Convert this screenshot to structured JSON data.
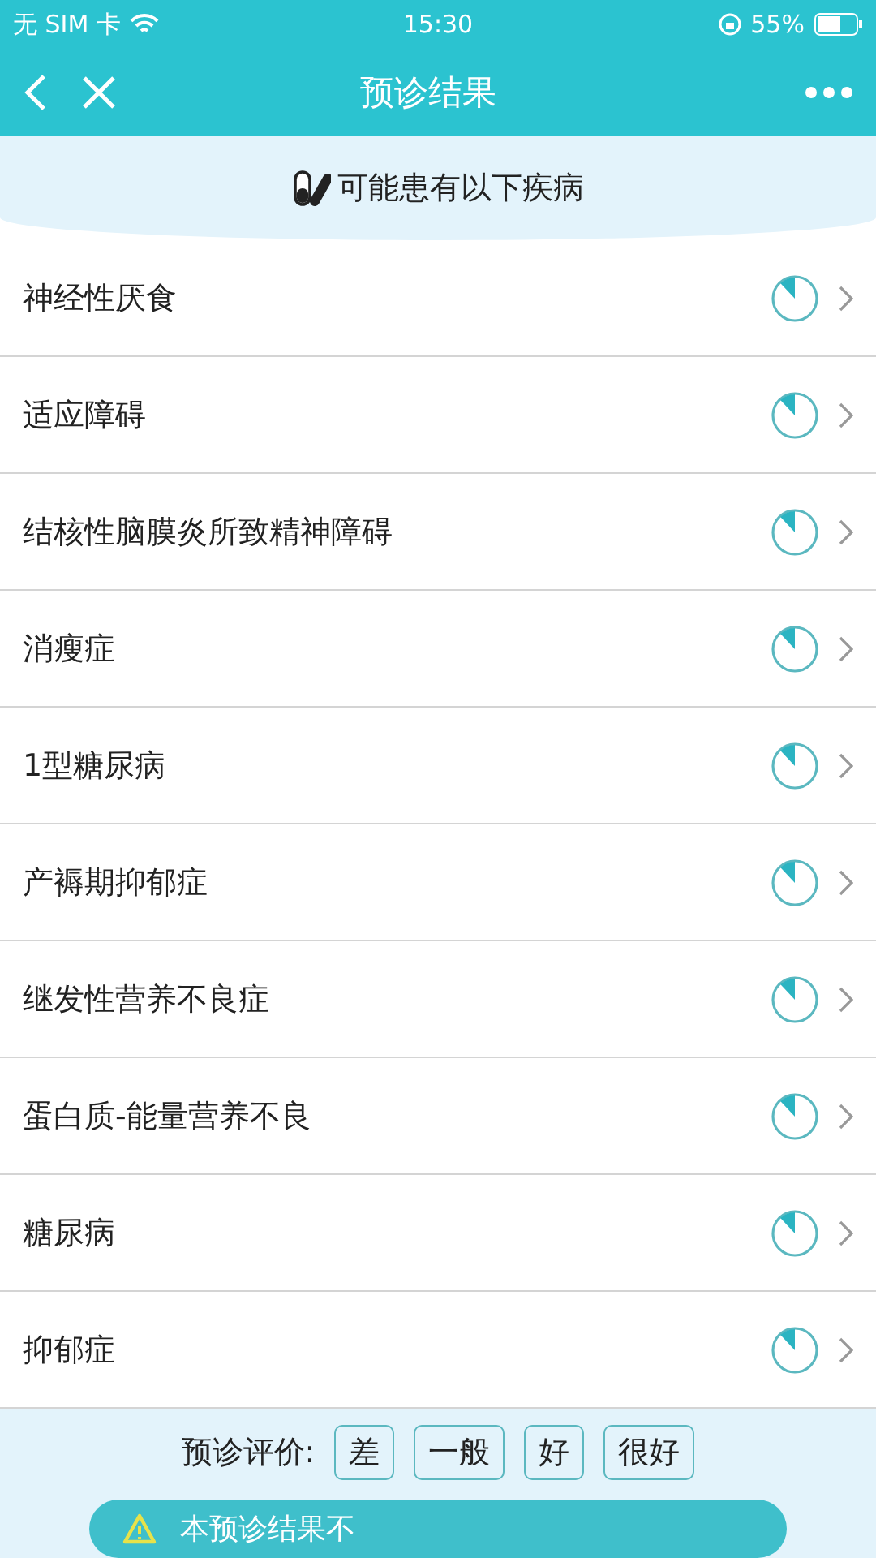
{
  "status_bar": {
    "carrier": "无 SIM 卡",
    "time": "15:30",
    "battery": "55%"
  },
  "nav": {
    "title": "预诊结果"
  },
  "header": {
    "text": "可能患有以下疾病"
  },
  "diseases": [
    {
      "name": "神经性厌食"
    },
    {
      "name": "适应障碍"
    },
    {
      "name": "结核性脑膜炎所致精神障碍"
    },
    {
      "name": "消瘦症"
    },
    {
      "name": "1型糖尿病"
    },
    {
      "name": "产褥期抑郁症"
    },
    {
      "name": "继发性营养不良症"
    },
    {
      "name": "蛋白质-能量营养不良"
    },
    {
      "name": "糖尿病"
    },
    {
      "name": "抑郁症"
    }
  ],
  "rating": {
    "label": "预诊评价:",
    "options": [
      "差",
      "一般",
      "好",
      "很好"
    ]
  },
  "notice": {
    "text": "本预诊结果不"
  }
}
